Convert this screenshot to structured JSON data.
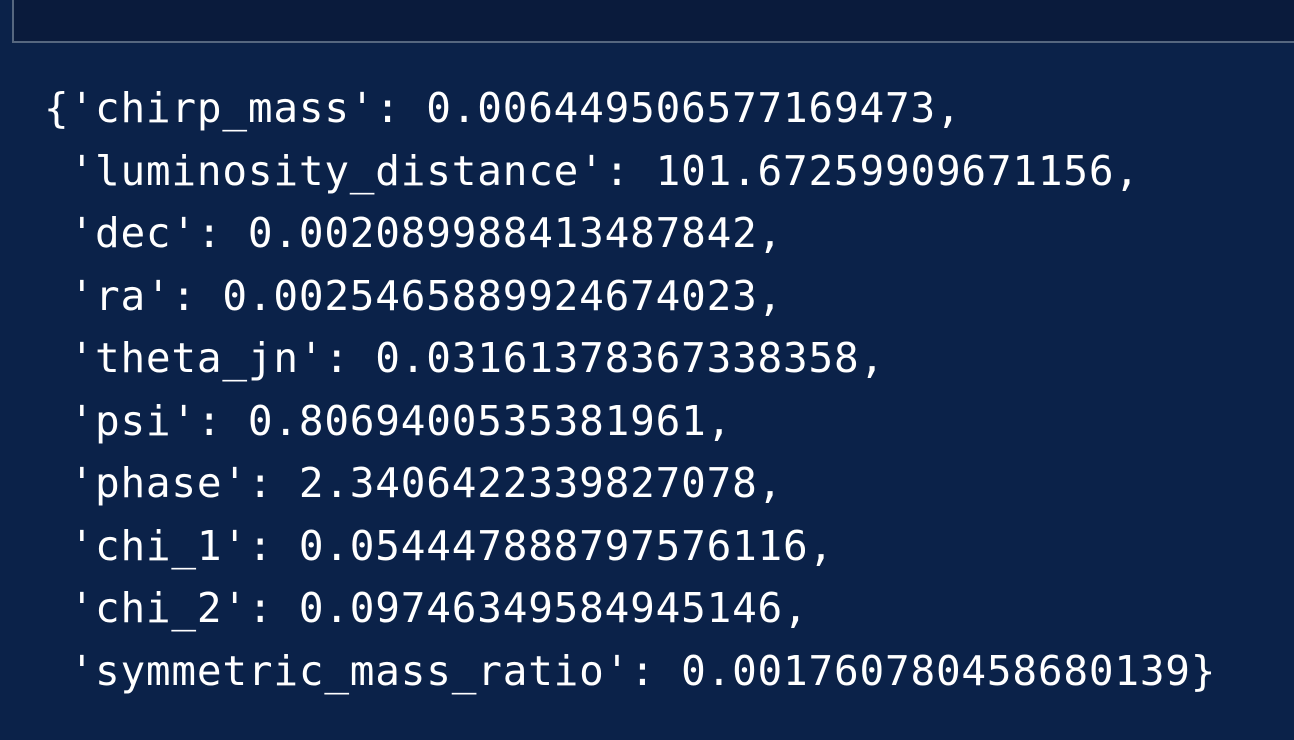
{
  "output": {
    "lines": [
      "{'chirp_mass': 0.006449506577169473,",
      " 'luminosity_distance': 101.67259909671156,",
      " 'dec': 0.002089988413487842,",
      " 'ra': 0.002546588992467402​3,",
      " 'theta_jn': 0.03161378367338358,",
      " 'psi': 0.8069400535381961,",
      " 'phase': 2.3406422339827078,",
      " 'chi_1': 0.05444788879757611​6,",
      " 'chi_2': 0.09746349584945146,",
      " 'symmetric_mass_ratio': 0.0017607804586801​39}"
    ]
  },
  "colors": {
    "background": "#0b2249",
    "top_cell": "#0a1b3c",
    "cell_border": "#56677f",
    "text": "#ffffff"
  }
}
